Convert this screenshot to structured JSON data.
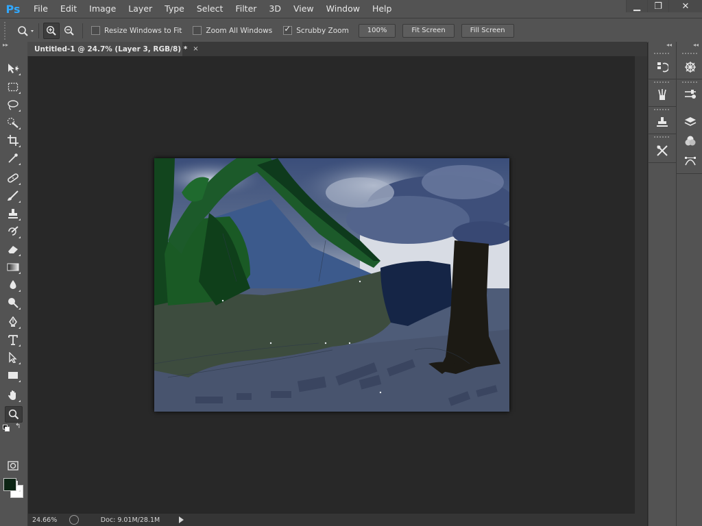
{
  "app": {
    "logo": "Ps"
  },
  "menu": [
    "File",
    "Edit",
    "Image",
    "Layer",
    "Type",
    "Select",
    "Filter",
    "3D",
    "View",
    "Window",
    "Help"
  ],
  "window_controls": {
    "minimize": "▁",
    "restore": "❐",
    "close": "✕"
  },
  "options": {
    "resize_windows_label": "Resize Windows to Fit",
    "resize_windows_checked": false,
    "zoom_all_label": "Zoom All Windows",
    "zoom_all_checked": false,
    "scrubby_zoom_label": "Scrubby Zoom",
    "scrubby_zoom_checked": true,
    "btn_100": "100%",
    "btn_fit": "Fit Screen",
    "btn_fill": "Fill Screen"
  },
  "document": {
    "tab_title": "Untitled-1 @ 24.7% (Layer 3, RGB/8) *",
    "tab_close": "×"
  },
  "toolbar": {
    "collapse": "▸▸"
  },
  "status": {
    "zoom": "24.66%",
    "doc": "Doc: 9.01M/28.1M"
  },
  "colors": {
    "foreground": "#0c2414",
    "background": "#ffffff",
    "ui_panel": "#535353",
    "workspace": "#282828",
    "logo_blue": "#31a8ff"
  }
}
